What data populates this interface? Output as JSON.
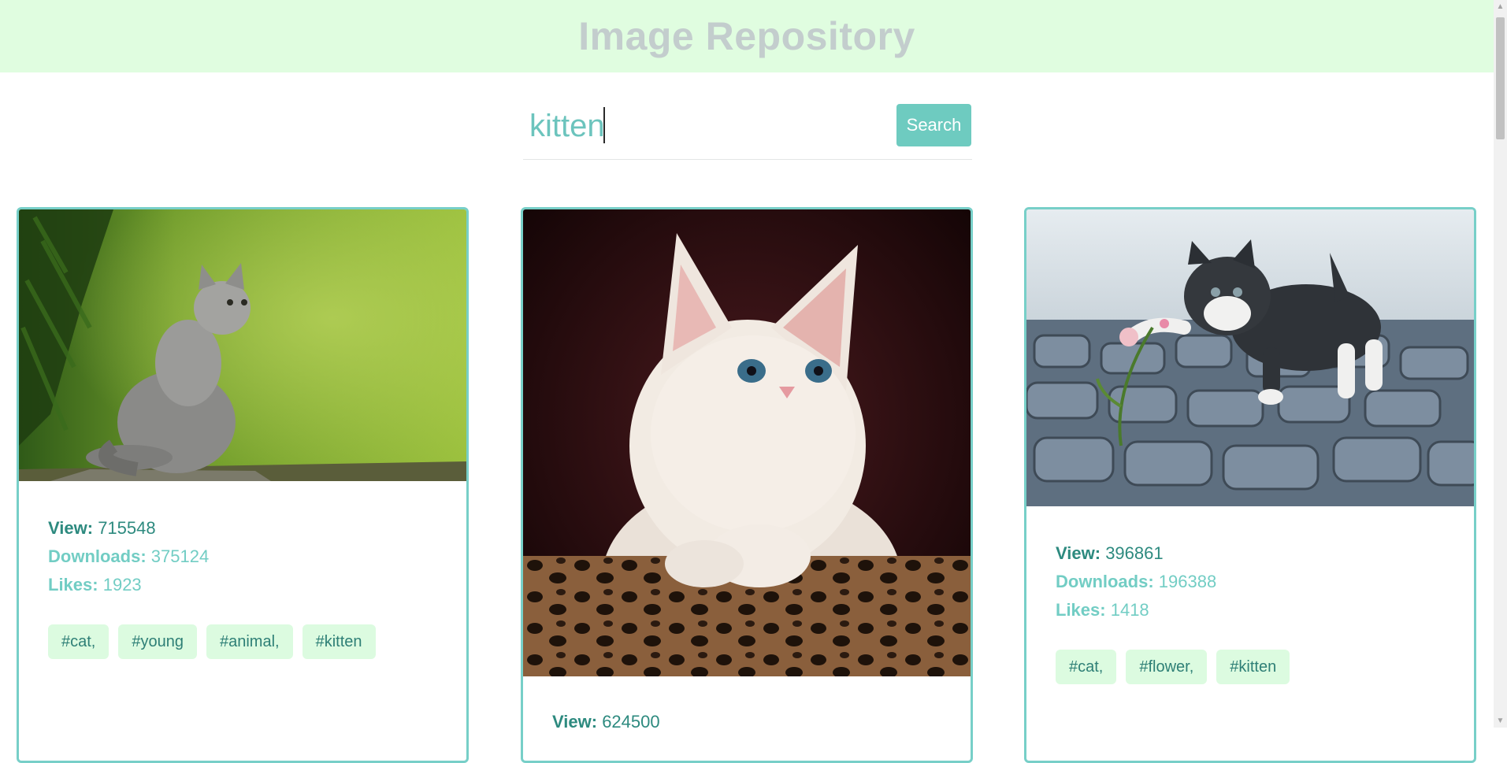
{
  "header": {
    "title": "Image Repository"
  },
  "search": {
    "value": "kitten",
    "button_label": "Search"
  },
  "labels": {
    "view": "View:",
    "downloads": "Downloads:",
    "likes": "Likes:"
  },
  "cards": [
    {
      "image": "gray kitten sitting on a branch looking up",
      "view": "715548",
      "downloads": "375124",
      "likes": "1923",
      "tags": [
        "#cat,",
        "#young",
        "#animal,",
        "#kitten"
      ]
    },
    {
      "image": "white kitten peeking over a leopard-print cushion",
      "view": "624500"
    },
    {
      "image": "black and white kitten pawing at a flower on cobblestones",
      "view": "396861",
      "downloads": "196388",
      "likes": "1418",
      "tags": [
        "#cat,",
        "#flower,",
        "#kitten"
      ]
    }
  ],
  "colors": {
    "header_bg": "#e0fde0",
    "accent": "#6ecbc0",
    "card_border": "#77cfc8",
    "tag_bg": "#dcfbe0"
  }
}
